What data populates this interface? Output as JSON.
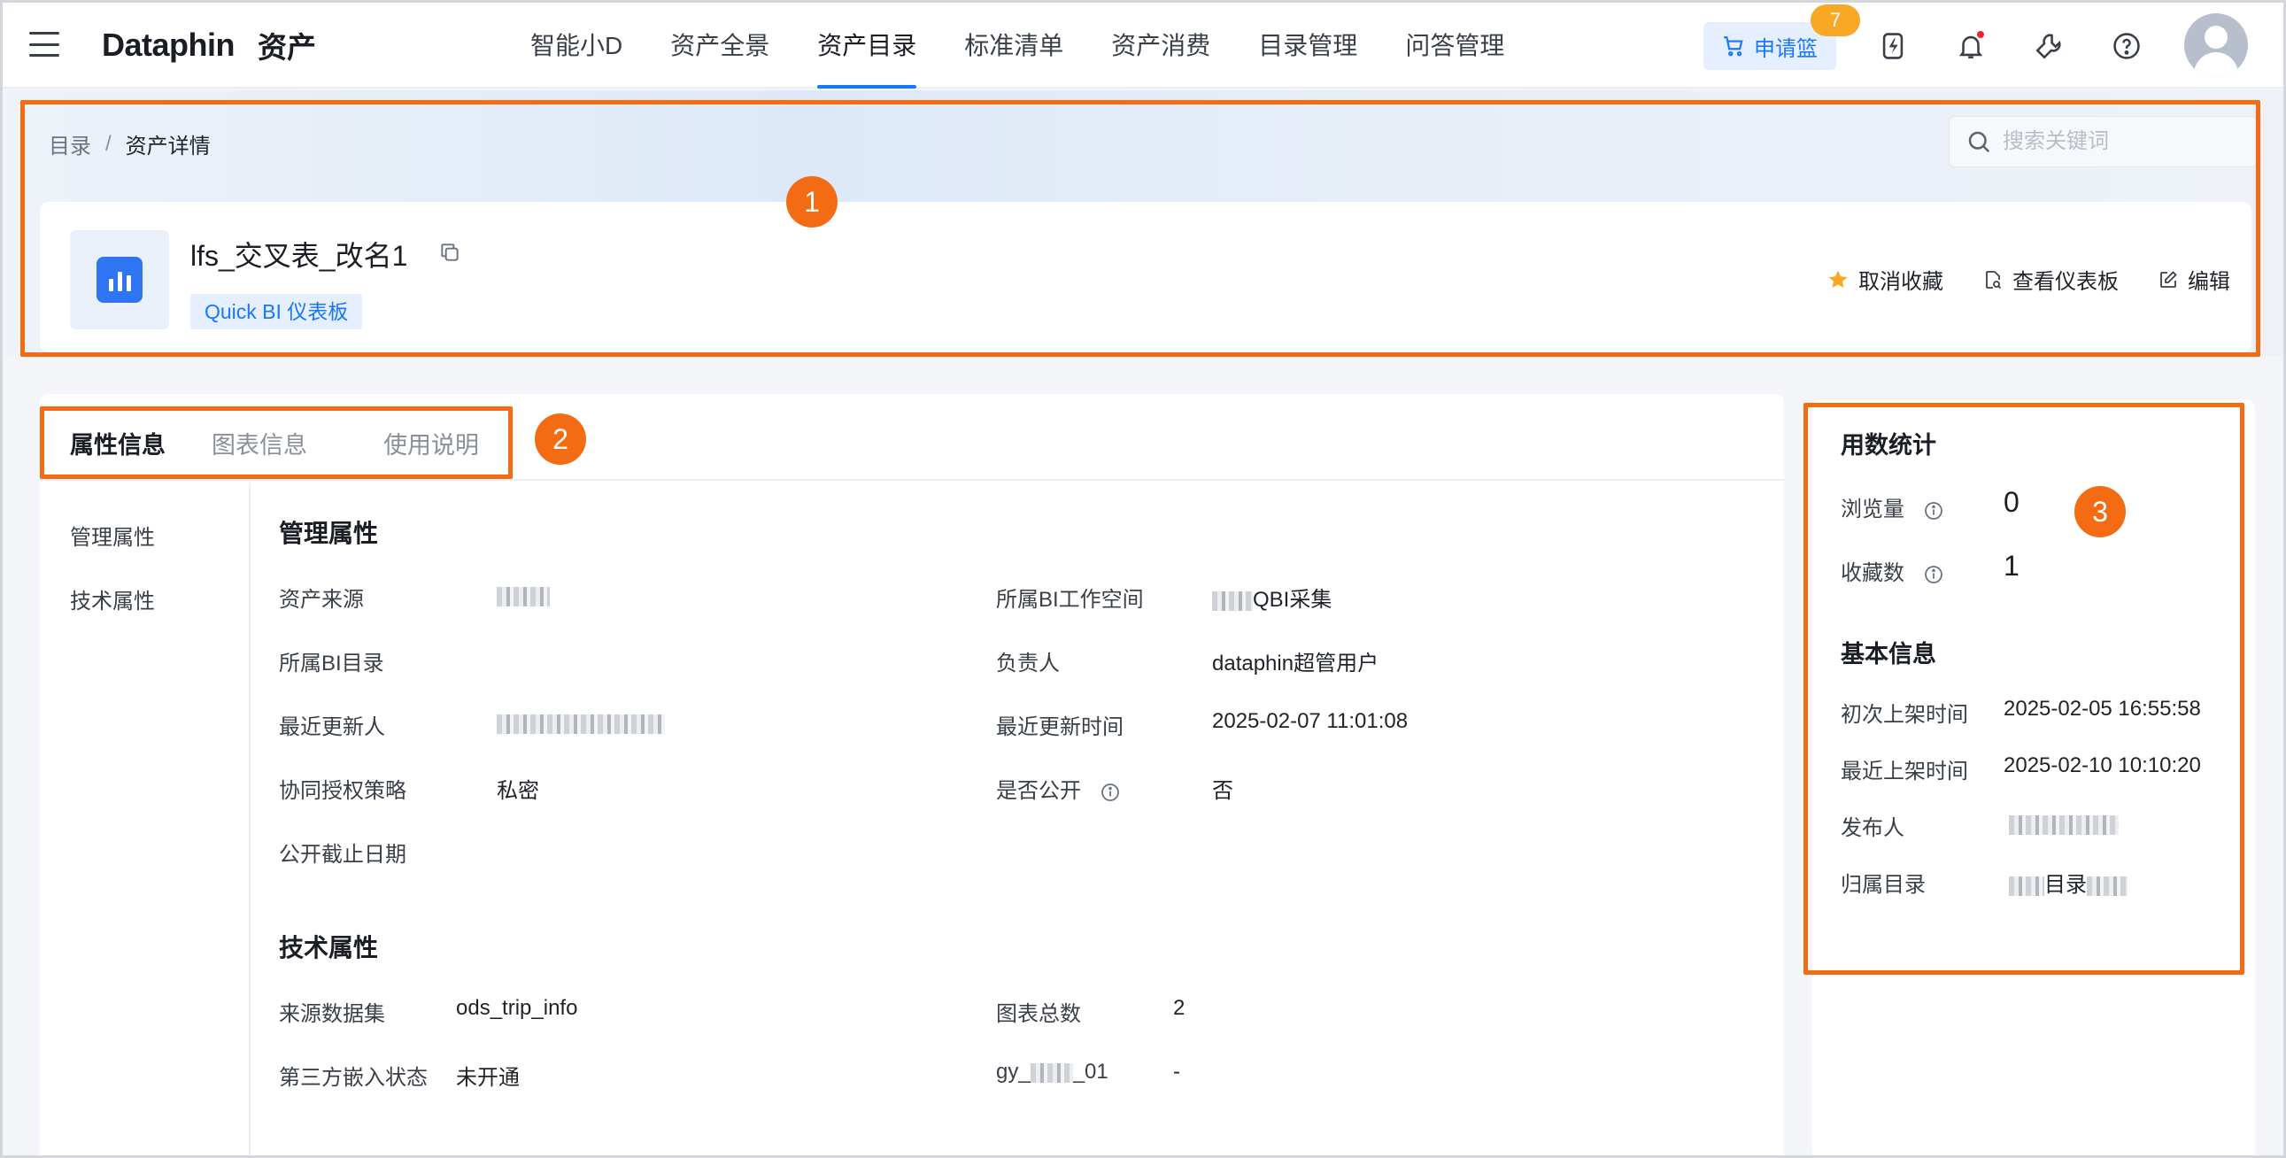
{
  "nav": {
    "brand": "Dataphin",
    "product": "资产",
    "items": [
      {
        "label": "智能小D",
        "active": false
      },
      {
        "label": "资产全景",
        "active": false
      },
      {
        "label": "资产目录",
        "active": true
      },
      {
        "label": "标准清单",
        "active": false
      },
      {
        "label": "资产消费",
        "active": false
      },
      {
        "label": "目录管理",
        "active": false
      },
      {
        "label": "问答管理",
        "active": false
      }
    ],
    "cart_label": "申请篮",
    "cart_count": "7",
    "icons": [
      "cart-icon",
      "flash-icon",
      "bell-icon",
      "wrench-icon",
      "help-icon",
      "avatar"
    ],
    "accent_color": "#1677ff"
  },
  "breadcrumb": {
    "root": "目录",
    "separator": "/",
    "current": "资产详情"
  },
  "search": {
    "placeholder": "搜索关键词"
  },
  "asset": {
    "title": "lfs_交叉表_改名1",
    "tag": "Quick BI 仪表板",
    "actions": {
      "unfavorite": "取消收藏",
      "view_dashboard": "查看仪表板",
      "edit": "编辑"
    }
  },
  "tabs": [
    "属性信息",
    "图表信息",
    "使用说明"
  ],
  "side_nav": [
    "管理属性",
    "技术属性"
  ],
  "management": {
    "title": "管理属性",
    "labels": {
      "source": "资产来源",
      "workspace": "所属BI工作空间",
      "bi_dir": "所属BI目录",
      "owner": "负责人",
      "updater": "最近更新人",
      "update_time": "最近更新时间",
      "policy": "协同授权策略",
      "is_public": "是否公开",
      "public_end": "公开截止日期"
    },
    "values": {
      "workspace_suffix": "QBI采集",
      "owner": "dataphin超管用户",
      "update_time": "2025-02-07 11:01:08",
      "policy": "私密",
      "is_public": "否"
    }
  },
  "technical": {
    "title": "技术属性",
    "labels": {
      "dataset": "来源数据集",
      "chart_total": "图表总数",
      "embed_status": "第三方嵌入状态",
      "gy_prefix": "gy_",
      "gy_suffix": "_01"
    },
    "values": {
      "dataset": "ods_trip_info",
      "chart_total": "2",
      "embed_status": "未开通",
      "gy_value": "-"
    }
  },
  "usage": {
    "title": "用数统计",
    "views_label": "浏览量",
    "views": "0",
    "favorites_label": "收藏数",
    "favorites": "1"
  },
  "basic": {
    "title": "基本信息",
    "first_listed_label": "初次上架时间",
    "first_listed": "2025-02-05 16:55:58",
    "last_listed_label": "最近上架时间",
    "last_listed": "2025-02-10 10:10:20",
    "publisher_label": "发布人",
    "directory_label": "归属目录",
    "directory_mid": "目录"
  },
  "markers": [
    "1",
    "2",
    "3"
  ],
  "highlight_color": "#f36b12"
}
